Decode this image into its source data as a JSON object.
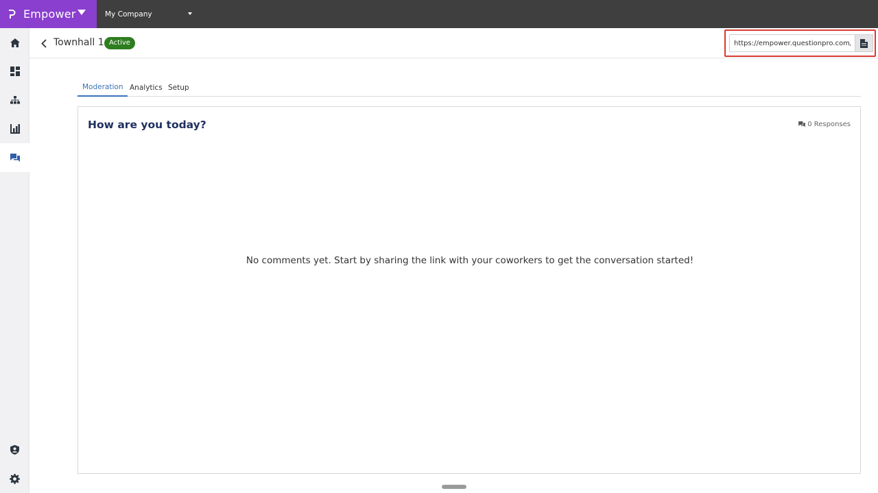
{
  "brand": {
    "name": "Empower",
    "accent": "#8a3fce"
  },
  "company": {
    "selected": "My Company"
  },
  "nav": {
    "items": [
      {
        "icon": "home-icon"
      },
      {
        "icon": "dashboard-icon"
      },
      {
        "icon": "org-chart-icon"
      },
      {
        "icon": "bar-chart-icon"
      },
      {
        "icon": "chat-icon",
        "active": true
      }
    ],
    "bottom": [
      {
        "icon": "shield-icon"
      },
      {
        "icon": "gear-icon"
      }
    ]
  },
  "header": {
    "title": "Townhall 1",
    "status": "Active",
    "status_color": "#2e7d1f",
    "share_url": "https://empower.questionpro.com/p"
  },
  "tabs": [
    {
      "label": "Moderation",
      "active": true
    },
    {
      "label": "Analytics"
    },
    {
      "label": "Setup"
    }
  ],
  "main": {
    "question": "How are you today?",
    "responses": "0 Responses",
    "empty_message": "No comments yet. Start by sharing the link with your coworkers to get the conversation started!"
  }
}
